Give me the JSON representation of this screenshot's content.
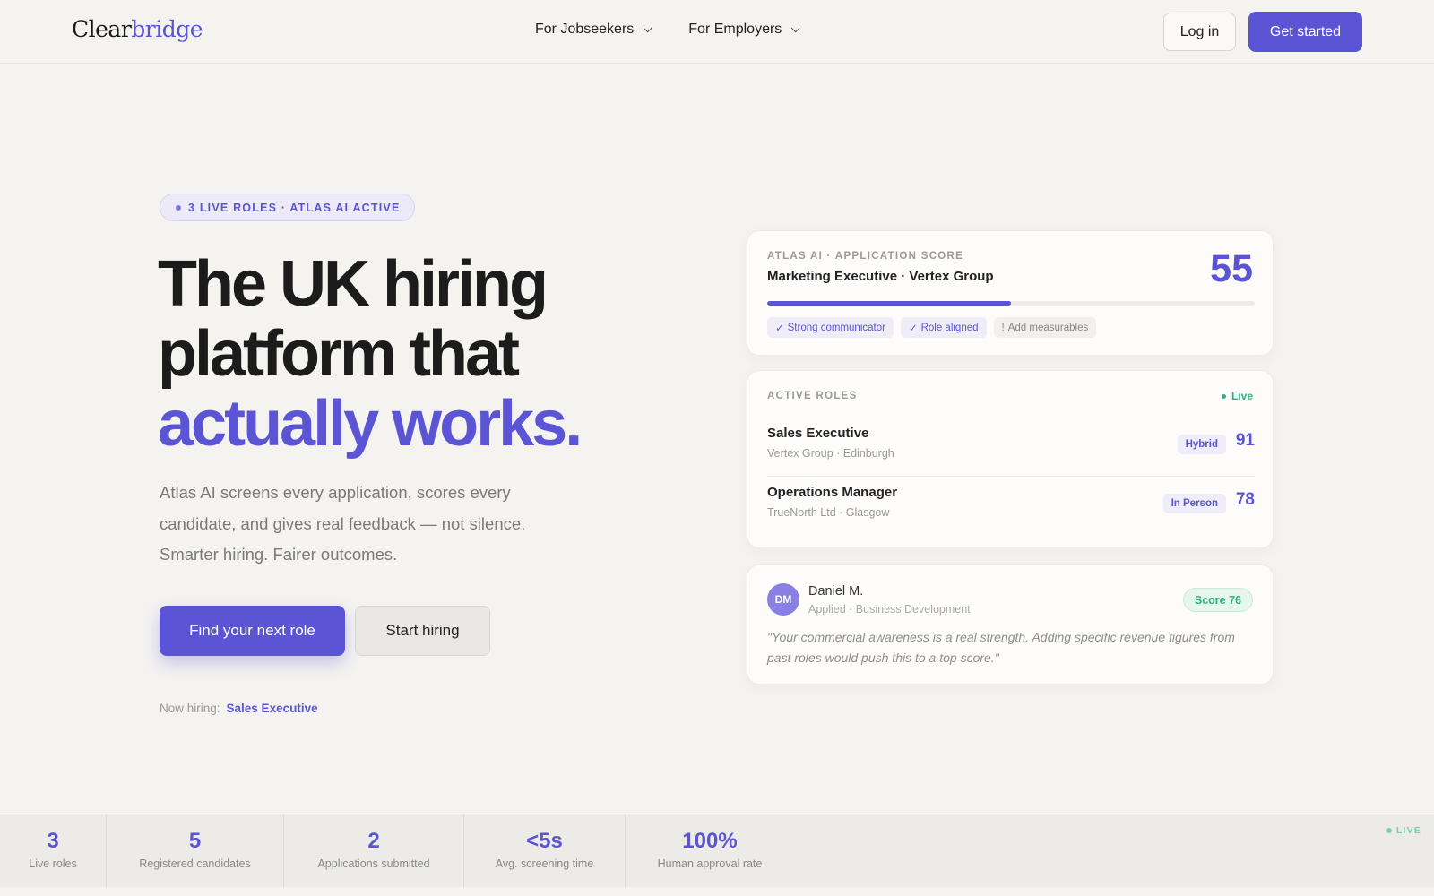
{
  "nav": {
    "logo_part1": "Clear",
    "logo_part2": "bridge",
    "menu": [
      {
        "label": "For Jobseekers"
      },
      {
        "label": "For Employers"
      }
    ],
    "login_label": "Log in",
    "get_started_label": "Get started"
  },
  "hero": {
    "pill_text": "3 LIVE ROLES · ATLAS AI ACTIVE",
    "headline_line1": "The UK hiring",
    "headline_line2": "platform that",
    "headline_accent": "actually works.",
    "lead": "Atlas AI screens every application, scores every candidate, and gives real feedback — not silence. Smarter hiring. Fairer outcomes.",
    "primary_cta": "Find your next role",
    "secondary_cta": "Start hiring",
    "now_hiring_label": "Now hiring:",
    "now_hiring_role": "Sales Executive"
  },
  "score_card": {
    "label": "ATLAS AI · APPLICATION SCORE",
    "title": "Marketing Executive · Vertex Group",
    "score": "55",
    "progress": 0.5,
    "tags": [
      {
        "icon": "check-icon",
        "label": "Strong communicator"
      },
      {
        "icon": "check-icon",
        "label": "Role aligned"
      },
      {
        "icon": "info-icon",
        "label": "Add measurables"
      }
    ]
  },
  "roles_card": {
    "label": "ACTIVE ROLES",
    "live_label": "Live",
    "roles": [
      {
        "title": "Sales Executive",
        "sub": "Vertex Group · Edinburgh",
        "badge": "Hybrid",
        "score": "91"
      },
      {
        "title": "Operations Manager",
        "sub": "TrueNorth Ltd · Glasgow",
        "badge": "In Person",
        "score": "78"
      }
    ]
  },
  "feedback_card": {
    "initials": "DM",
    "name": "Daniel M.",
    "sub": "Applied · Business Development",
    "score_label": "Score 76",
    "quote": "\"Your commercial awareness is a real strength. Adding specific revenue figures from past roles would push this to a top score.\""
  },
  "stats": {
    "live_label": "LIVE",
    "items": [
      {
        "value": "3",
        "label": "Live roles"
      },
      {
        "value": "5",
        "label": "Registered candidates"
      },
      {
        "value": "2",
        "label": "Applications submitted"
      },
      {
        "value": "<5s",
        "label": "Avg. screening time"
      },
      {
        "value": "100%",
        "label": "Human approval rate"
      }
    ]
  },
  "colors": {
    "accent": "#5b55d6",
    "success": "#2fae84",
    "background": "#f4f3f0"
  }
}
